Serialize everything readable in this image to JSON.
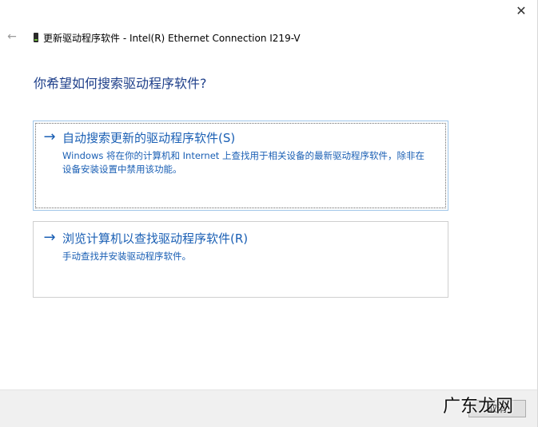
{
  "window": {
    "close_glyph": "✕",
    "back_glyph": "←",
    "title": "更新驱动程序软件 - Intel(R) Ethernet Connection I219-V"
  },
  "heading": "你希望如何搜索驱动程序软件?",
  "options": [
    {
      "icon": "arrow-right-icon",
      "arrow_glyph": "→",
      "title": "自动搜索更新的驱动程序软件(S)",
      "description": "Windows 将在你的计算机和 Internet 上查找用于相关设备的最新驱动程序软件，除非在设备安装设置中禁用该功能。"
    },
    {
      "icon": "arrow-right-icon",
      "arrow_glyph": "→",
      "title": "浏览计算机以查找驱动程序软件(R)",
      "description": "手动查找并安装驱动程序软件。"
    }
  ],
  "footer": {
    "cancel_label": "取消"
  },
  "watermark": "广东龙网",
  "colors": {
    "link_blue": "#1a5fb4",
    "heading_blue": "#1e3f8a",
    "footer_bg": "#f0f0f0"
  }
}
